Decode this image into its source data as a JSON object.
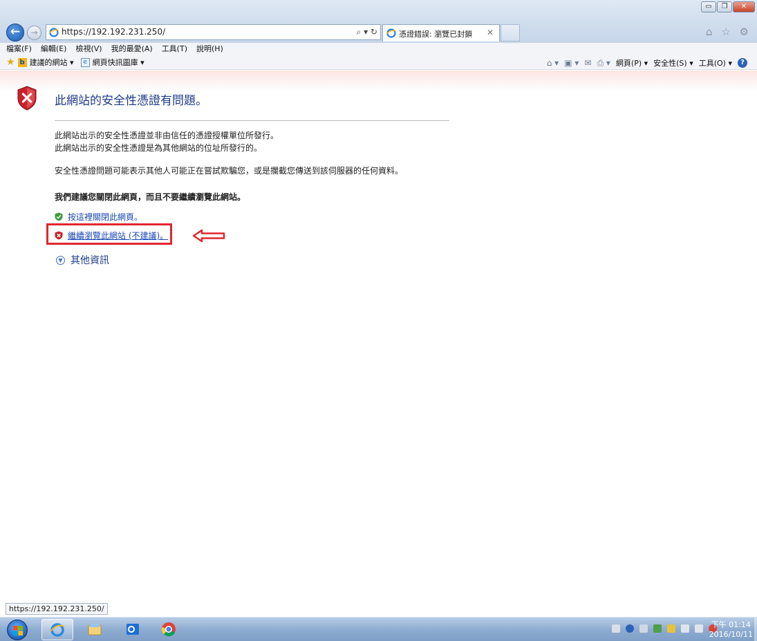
{
  "browser": {
    "url": "https://192.192.231.250/",
    "address_tools": "⌕ ▾ ↻",
    "tab_title": "憑證錯誤: 瀏覽已封鎖",
    "window_controls": [
      "▭",
      "❐",
      "✕"
    ],
    "right_icons": "⌂ ☆ ⚙"
  },
  "menu": {
    "items": [
      "檔案(F)",
      "編輯(E)",
      "檢視(V)",
      "我的最愛(A)",
      "工具(T)",
      "說明(H)"
    ]
  },
  "favorites": {
    "suggested_sites": "建議的網站 ▾",
    "web_slice_gallery": "網頁快訊圖庫 ▾"
  },
  "command_bar": {
    "page": "網頁(P) ▾",
    "safety": "安全性(S) ▾",
    "tools": "工具(O) ▾"
  },
  "error_page": {
    "title": "此網站的安全性憑證有問題。",
    "line1": "此網站出示的安全性憑證並非由信任的憑證授權單位所發行。",
    "line2": "此網站出示的安全性憑證是為其他網站的位址所發行的。",
    "line3": "安全性憑證問題可能表示其他人可能正在嘗試欺騙您，或是攔截您傳送到該伺服器的任何資料。",
    "recommendation": "我們建議您關閉此網頁，而且不要繼續瀏覽此網站。",
    "close_link": "按這裡關閉此網頁。",
    "continue_link": "繼續瀏覽此網站 (不建議)。",
    "more_info": "其他資訊"
  },
  "status_bar": {
    "url": "https://192.192.231.250/"
  },
  "taskbar": {
    "clock_time": "下午 01:14",
    "clock_date": "2016/10/11"
  },
  "colors": {
    "accent": "#1a47b5",
    "title_blue": "#1f3c88",
    "highlight_red": "#e0262e"
  }
}
